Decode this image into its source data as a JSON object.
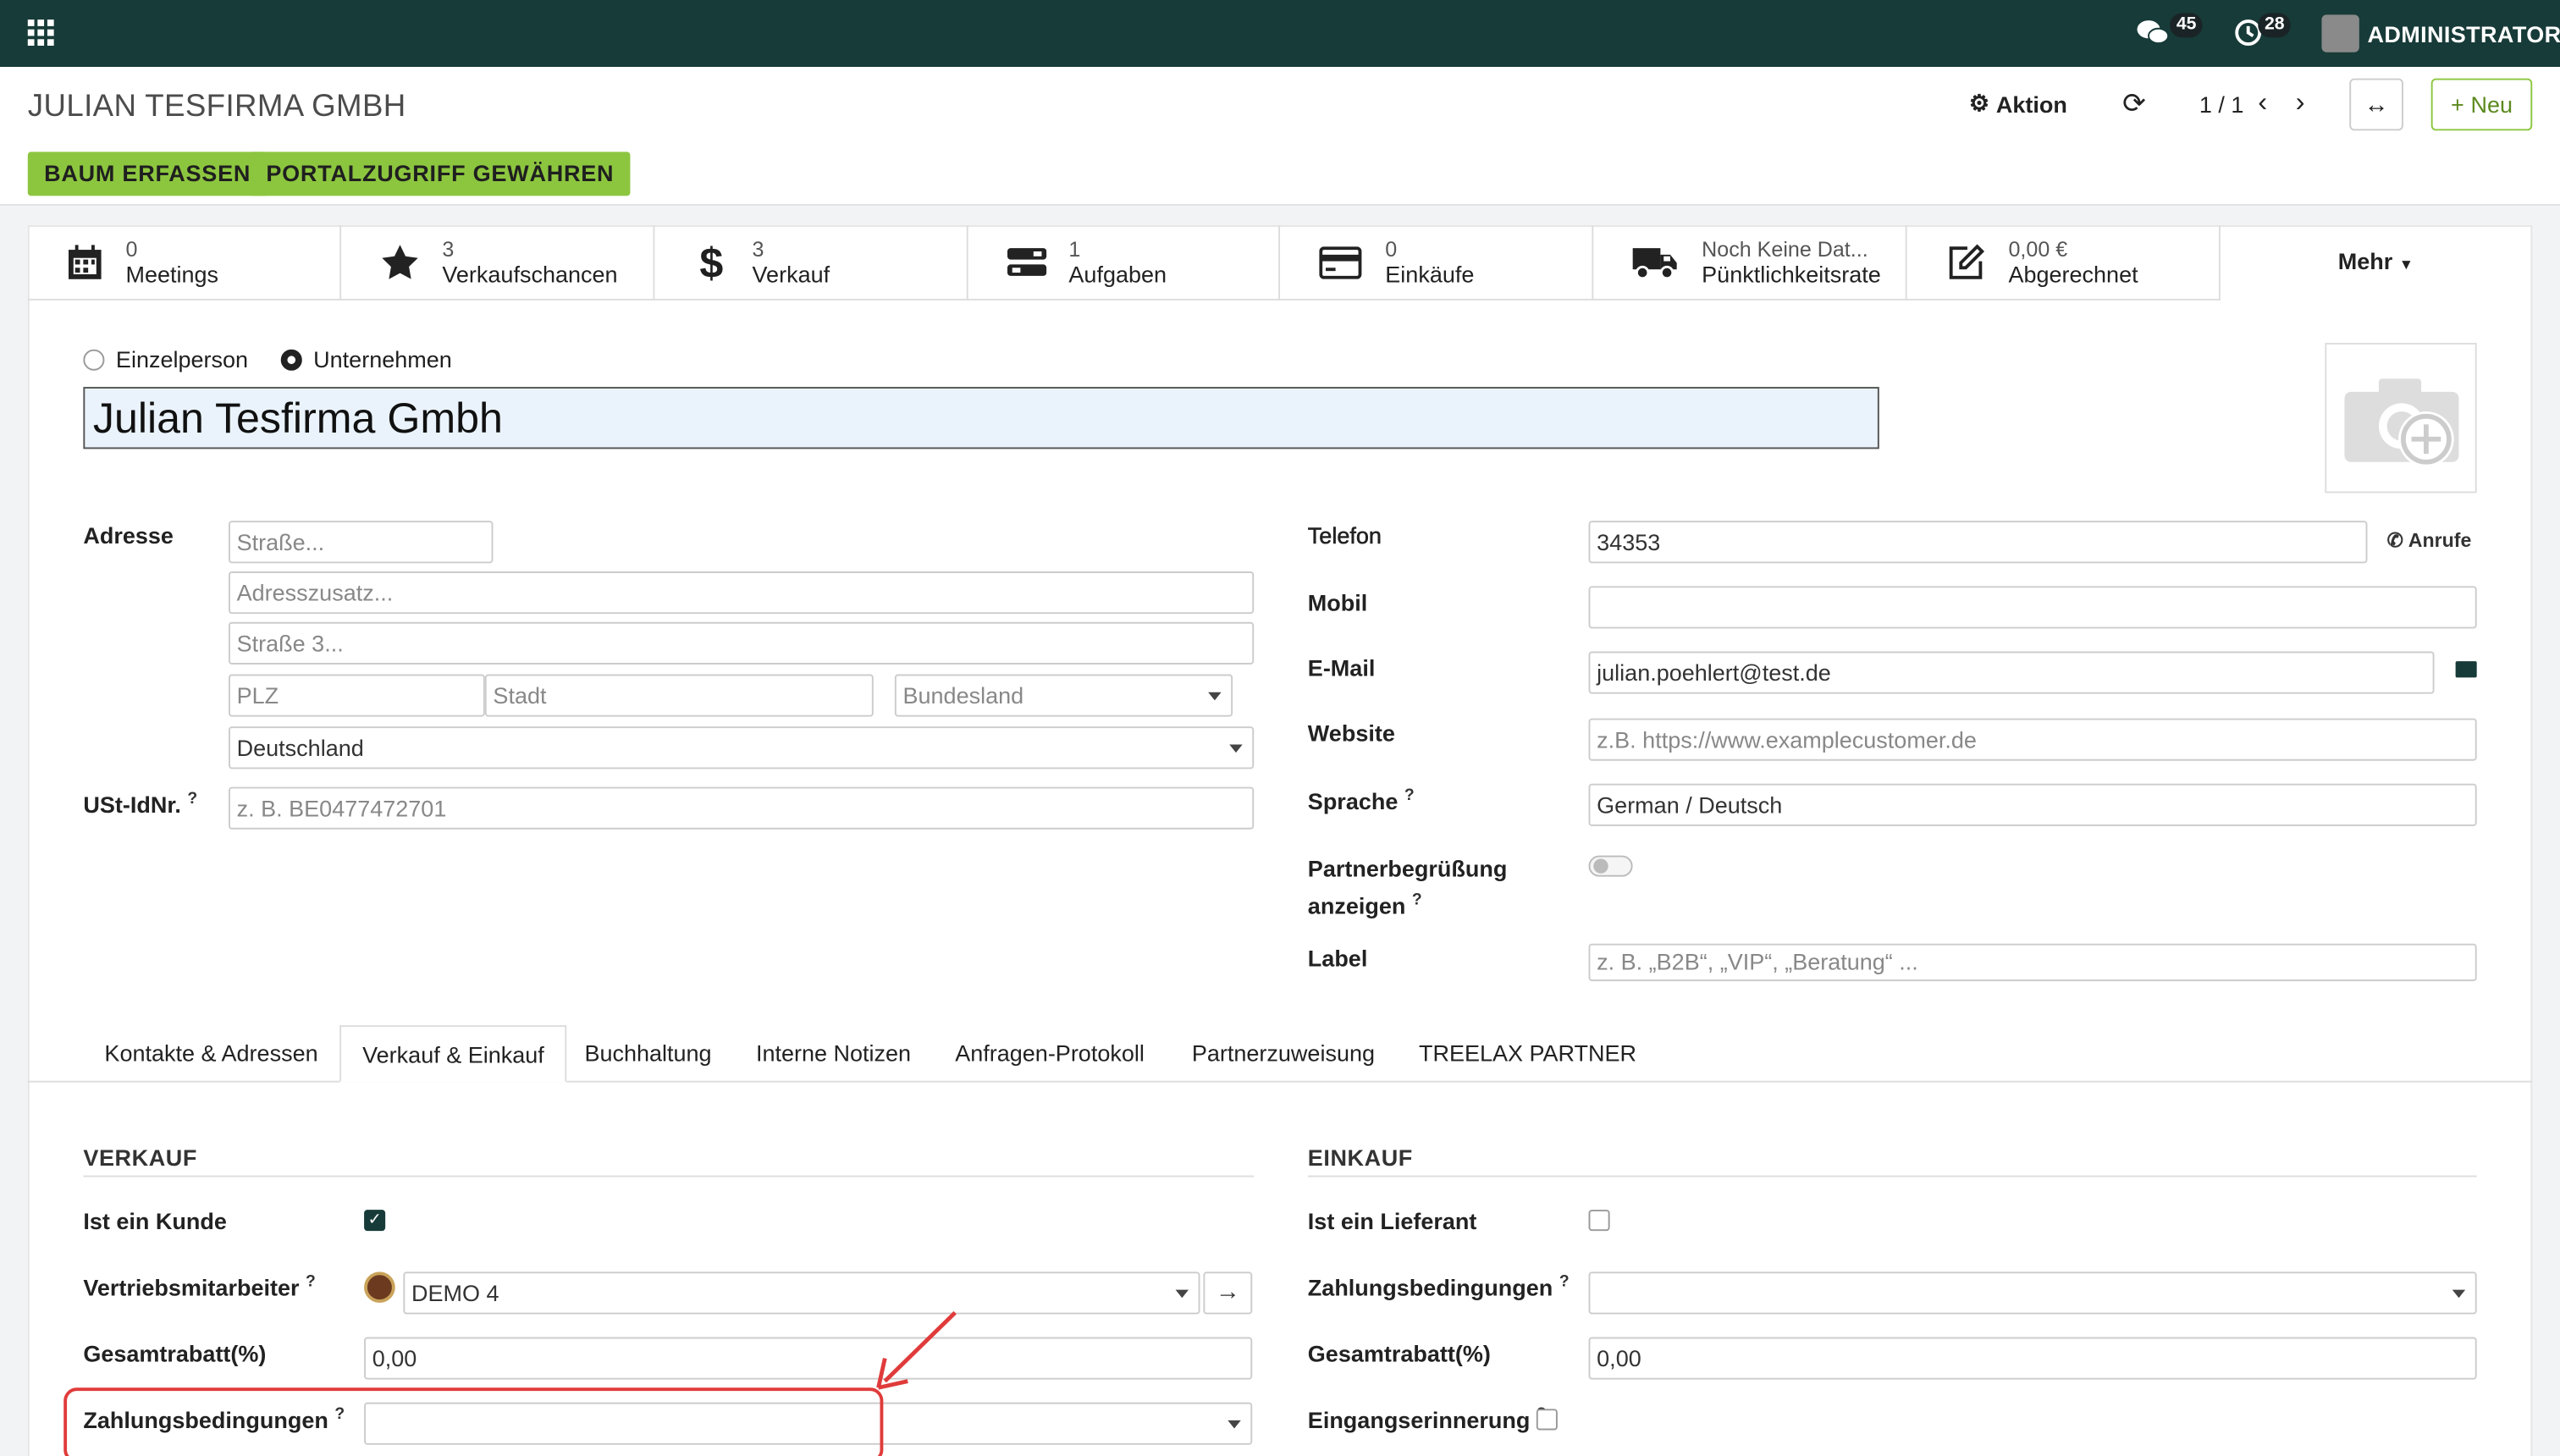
{
  "topbar": {
    "chat_count": "45",
    "activity_count": "28",
    "user": "ADMINISTRATOR"
  },
  "breadcrumb": "JULIAN TESFIRMA GMBH",
  "toolbar": {
    "action": "Aktion",
    "pager": "1 / 1",
    "new": "Neu"
  },
  "header_buttons": [
    "BAUM ERFASSEN",
    "PORTALZUGRIFF GEWÄHREN"
  ],
  "stats": [
    {
      "value": "0",
      "label": "Meetings",
      "icon": "calendar-icon"
    },
    {
      "value": "3",
      "label": "Verkaufschancen",
      "icon": "star-icon"
    },
    {
      "value": "3",
      "label": "Verkauf",
      "icon": "dollar-icon"
    },
    {
      "value": "1",
      "label": "Aufgaben",
      "icon": "tasks-icon"
    },
    {
      "value": "0",
      "label": "Einkäufe",
      "icon": "credit-card-icon"
    },
    {
      "value": "Noch Keine Dat...",
      "label": "Pünktlichkeitsrate",
      "icon": "truck-icon"
    },
    {
      "value": "0,00 €",
      "label": "Abgerechnet",
      "icon": "edit-icon"
    }
  ],
  "more": "Mehr",
  "company_type": {
    "person": "Einzelperson",
    "company": "Unternehmen",
    "selected": "company"
  },
  "name": "Julian Tesfirma Gmbh",
  "address": {
    "label": "Adresse",
    "street_ph": "Straße...",
    "street2_ph": "Adresszusatz...",
    "street3_ph": "Straße 3...",
    "zip_ph": "PLZ",
    "city_ph": "Stadt",
    "state_ph": "Bundesland",
    "country": "Deutschland"
  },
  "vat": {
    "label": "USt-IdNr.",
    "placeholder": "z. B. BE0477472701"
  },
  "contact": {
    "phone_label": "Telefon",
    "phone": "34353",
    "call": "Anrufe",
    "mobile_label": "Mobil",
    "mobile": "",
    "email_label": "E-Mail",
    "email": "julian.poehlert@test.de",
    "website_label": "Website",
    "website_ph": "z.B. https://www.examplecustomer.de",
    "lang_label": "Sprache",
    "lang": "German / Deutsch",
    "greeting_label_1": "Partnerbegrüßung",
    "greeting_label_2": "anzeigen",
    "tag_label": "Label",
    "tag_ph": "z. B. „B2B“, „VIP“, „Beratung“ ..."
  },
  "tabs": [
    "Kontakte & Adressen",
    "Verkauf & Einkauf",
    "Buchhaltung",
    "Interne Notizen",
    "Anfragen-Protokoll",
    "Partnerzuweisung",
    "TREELAX PARTNER"
  ],
  "active_tab": "Verkauf & Einkauf",
  "sales": {
    "title": "VERKAUF",
    "customer_label": "Ist ein Kunde",
    "customer": true,
    "salesperson_label": "Vertriebsmitarbeiter",
    "salesperson": "DEMO 4",
    "discount_label": "Gesamtrabatt(%)",
    "discount": "0,00",
    "terms_label": "Zahlungsbedingungen",
    "terms": ""
  },
  "purchase": {
    "title": "EINKAUF",
    "supplier_label": "Ist ein Lieferant",
    "supplier": false,
    "terms_label": "Zahlungsbedingungen",
    "terms": "",
    "discount_label": "Gesamtrabatt(%)",
    "discount": "0,00",
    "reminder_label": "Eingangserinnerung",
    "reminder": false
  },
  "colors": {
    "nav": "#173b38",
    "accent": "#8cc63f",
    "annotation": "#e03b3b"
  }
}
